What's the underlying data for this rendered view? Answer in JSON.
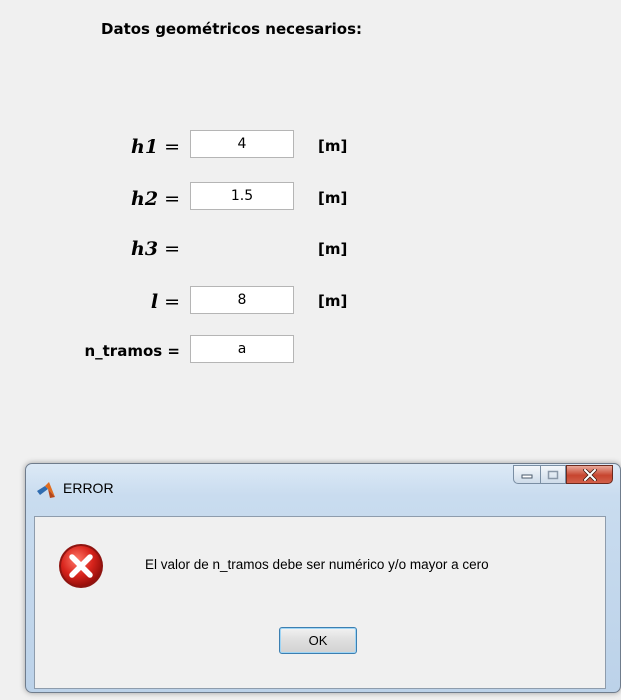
{
  "panel": {
    "title": "Datos geométricos necesarios:",
    "rows": [
      {
        "symbol": "h1",
        "equals": "=",
        "value": "4",
        "unit": "[m]"
      },
      {
        "symbol": "h2",
        "equals": "=",
        "value": "1.5",
        "unit": "[m]"
      },
      {
        "symbol": "h3",
        "equals": "=",
        "value": "",
        "unit": "[m]"
      },
      {
        "symbol": "l",
        "equals": "=",
        "value": "8",
        "unit": "[m]"
      },
      {
        "symbol": "n_tramos",
        "equals": "=",
        "value": "a",
        "unit": ""
      }
    ]
  },
  "dialog": {
    "title": "ERROR",
    "message": "El valor de n_tramos debe ser numérico y/o mayor a cero",
    "ok_label": "OK",
    "icons": {
      "app": "matlab-icon",
      "error": "error-icon",
      "minimize": "minimize-icon",
      "maximize": "maximize-icon",
      "close": "close-icon"
    },
    "colors": {
      "error_red": "#d8241c",
      "close_button": "#c7452f"
    }
  }
}
